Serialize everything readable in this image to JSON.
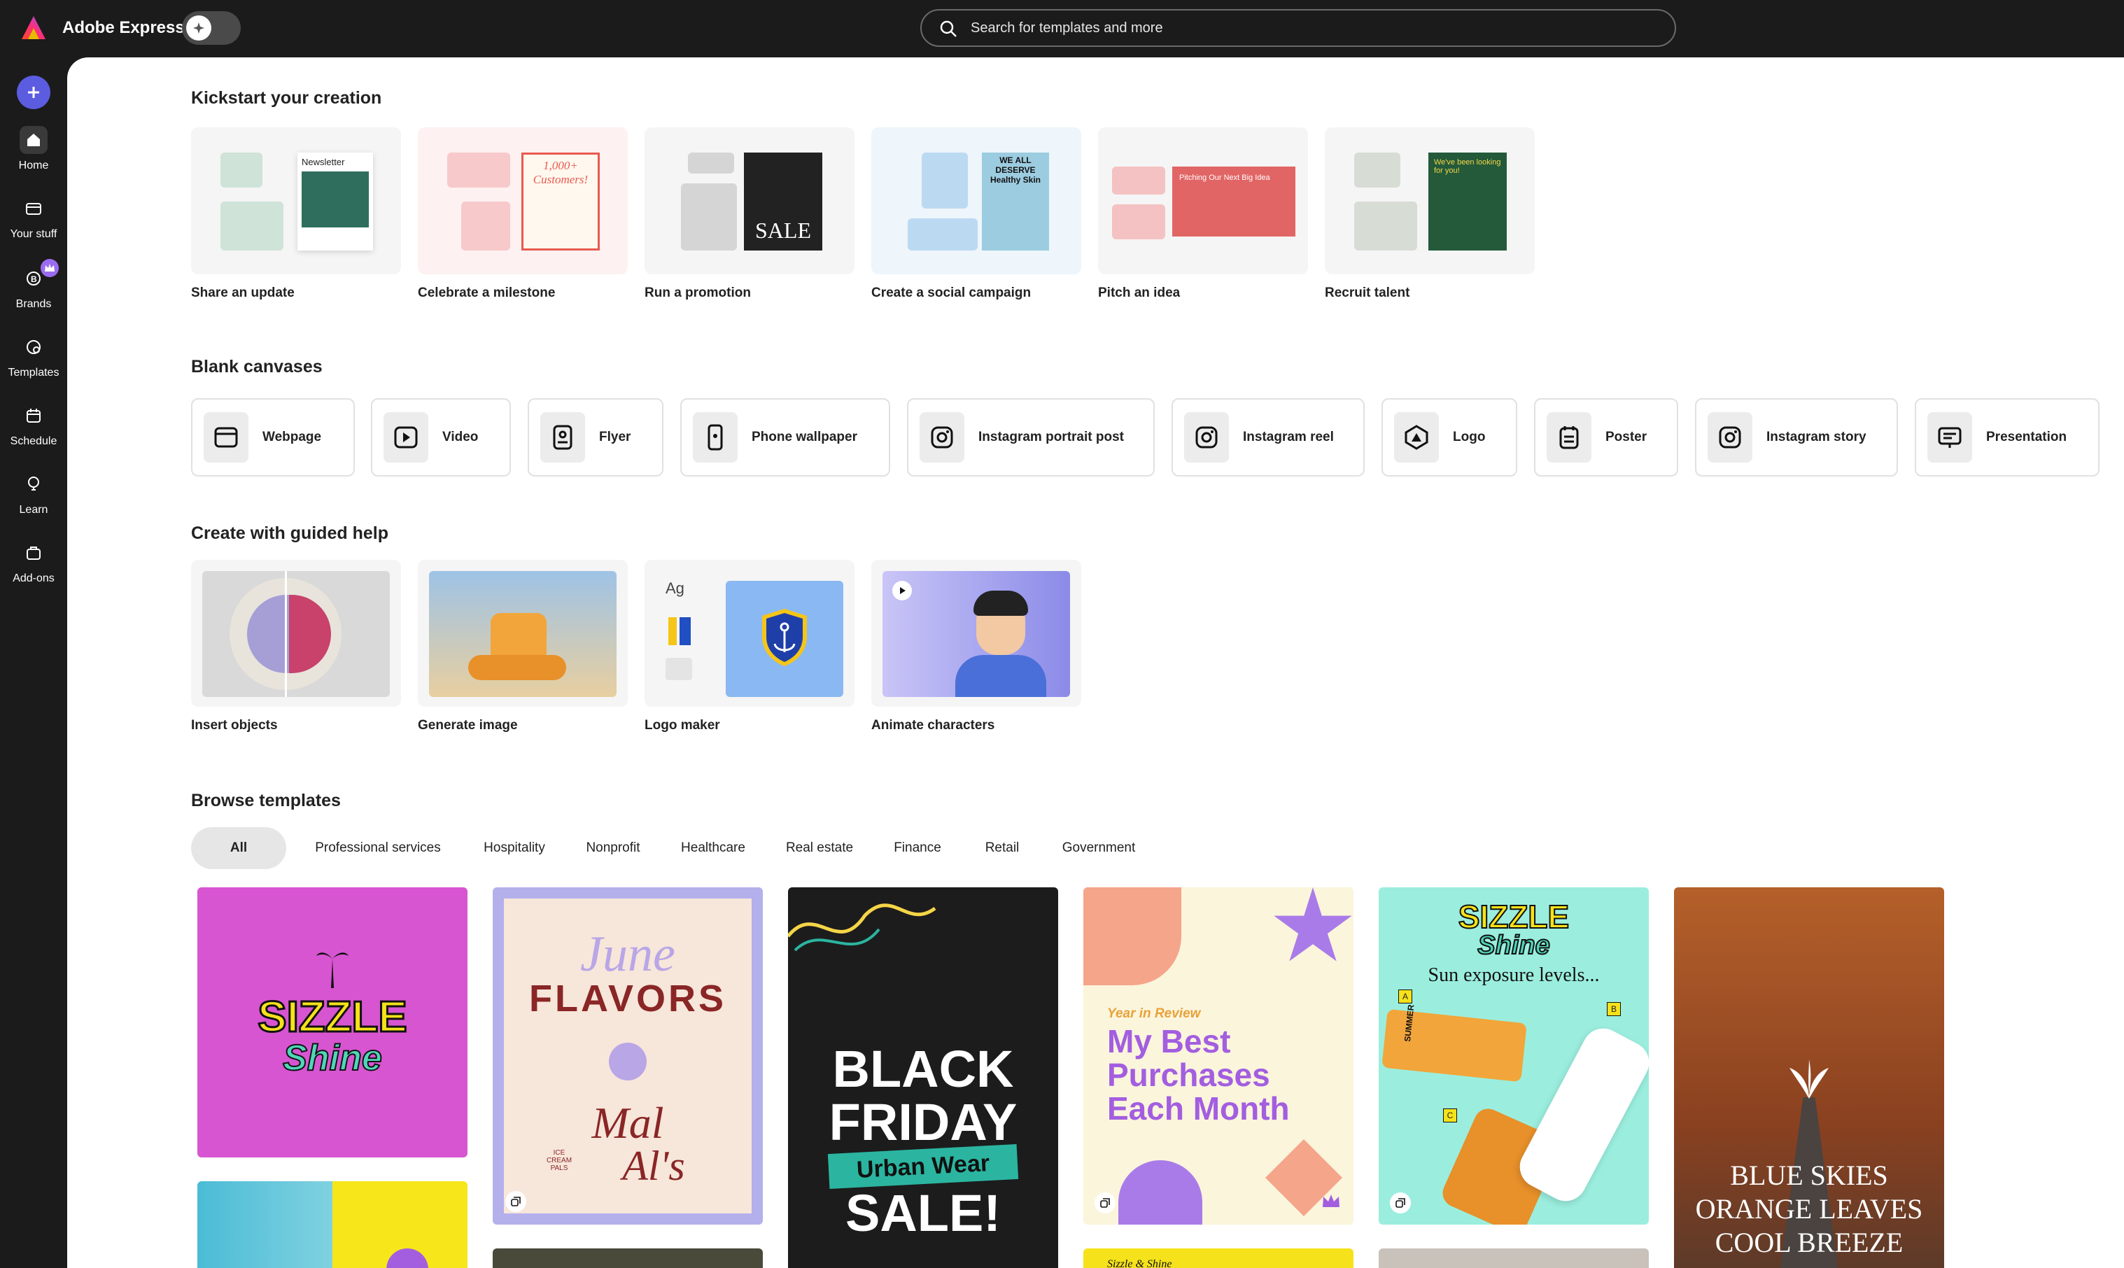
{
  "app": {
    "title": "Adobe Express"
  },
  "search": {
    "placeholder": "Search for templates and more"
  },
  "sidebar": {
    "items": [
      {
        "label": "Home",
        "icon": "home-icon",
        "active": true
      },
      {
        "label": "Your stuff",
        "icon": "folder-icon"
      },
      {
        "label": "Brands",
        "icon": "brand-icon"
      },
      {
        "label": "Templates",
        "icon": "templates-icon"
      },
      {
        "label": "Schedule",
        "icon": "calendar-icon"
      },
      {
        "label": "Learn",
        "icon": "lightbulb-icon"
      },
      {
        "label": "Add-ons",
        "icon": "addons-icon"
      }
    ]
  },
  "kickstart": {
    "title": "Kickstart your creation",
    "cards": [
      {
        "label": "Share an update",
        "thumb_text": "Newsletter"
      },
      {
        "label": "Celebrate a milestone",
        "thumb_text": "1,000+ Customers!"
      },
      {
        "label": "Run a promotion",
        "thumb_text": "SALE"
      },
      {
        "label": "Create a social campaign",
        "thumb_text": "WE ALL DESERVE Healthy Skin"
      },
      {
        "label": "Pitch an idea",
        "thumb_text": "Pitching Our Next Big Idea"
      },
      {
        "label": "Recruit talent",
        "thumb_text": "We've been looking for you!"
      }
    ]
  },
  "blank": {
    "title": "Blank canvases",
    "items": [
      {
        "label": "Webpage",
        "icon": "webpage-icon"
      },
      {
        "label": "Video",
        "icon": "video-icon"
      },
      {
        "label": "Flyer",
        "icon": "flyer-icon"
      },
      {
        "label": "Phone wallpaper",
        "icon": "phone-icon"
      },
      {
        "label": "Instagram portrait post",
        "icon": "instagram-icon"
      },
      {
        "label": "Instagram reel",
        "icon": "instagram-icon"
      },
      {
        "label": "Logo",
        "icon": "logo-icon"
      },
      {
        "label": "Poster",
        "icon": "poster-icon"
      },
      {
        "label": "Instagram story",
        "icon": "instagram-icon"
      },
      {
        "label": "Presentation",
        "icon": "presentation-icon"
      }
    ]
  },
  "guided": {
    "title": "Create with guided help",
    "cards": [
      {
        "label": "Insert objects"
      },
      {
        "label": "Generate image"
      },
      {
        "label": "Logo maker",
        "thumb_text": "Ag"
      },
      {
        "label": "Animate characters"
      }
    ]
  },
  "browse": {
    "title": "Browse templates",
    "chips": [
      "All",
      "Professional services",
      "Hospitality",
      "Nonprofit",
      "Healthcare",
      "Real estate",
      "Finance",
      "Retail",
      "Government"
    ],
    "templates": [
      {
        "name": "sizzle-shine-pink",
        "lines": [
          "SIZZLE",
          "Shine"
        ]
      },
      {
        "name": "june-flavors",
        "lines": [
          "June",
          "FLAVORS",
          "Mal",
          "Al's",
          "ICE CREAM PALS"
        ]
      },
      {
        "name": "black-friday",
        "lines": [
          "BLACK",
          "FRIDAY",
          "Urban Wear",
          "SALE!"
        ]
      },
      {
        "name": "year-in-review",
        "lines": [
          "Year in Review",
          "My Best",
          "Purchases",
          "Each Month"
        ]
      },
      {
        "name": "sizzle-sunscreen",
        "lines": [
          "SIZZLE",
          "Shine",
          "Sun exposure levels...",
          "A",
          "B",
          "C",
          "SUMMER"
        ]
      },
      {
        "name": "blue-skies",
        "lines": [
          "BLUE SKIES",
          "ORANGE LEAVES",
          "COOL BREEZE"
        ]
      },
      {
        "name": "beach-yellow",
        "lines": []
      },
      {
        "name": "landscape-dark",
        "lines": []
      },
      {
        "name": "sizzle-yellow-strip",
        "lines": [
          "Sizzle & Shine"
        ]
      },
      {
        "name": "neutral-strip",
        "lines": []
      }
    ]
  },
  "colors": {
    "accent": "#5c5ce0",
    "topbar": "#1b1b1b"
  }
}
